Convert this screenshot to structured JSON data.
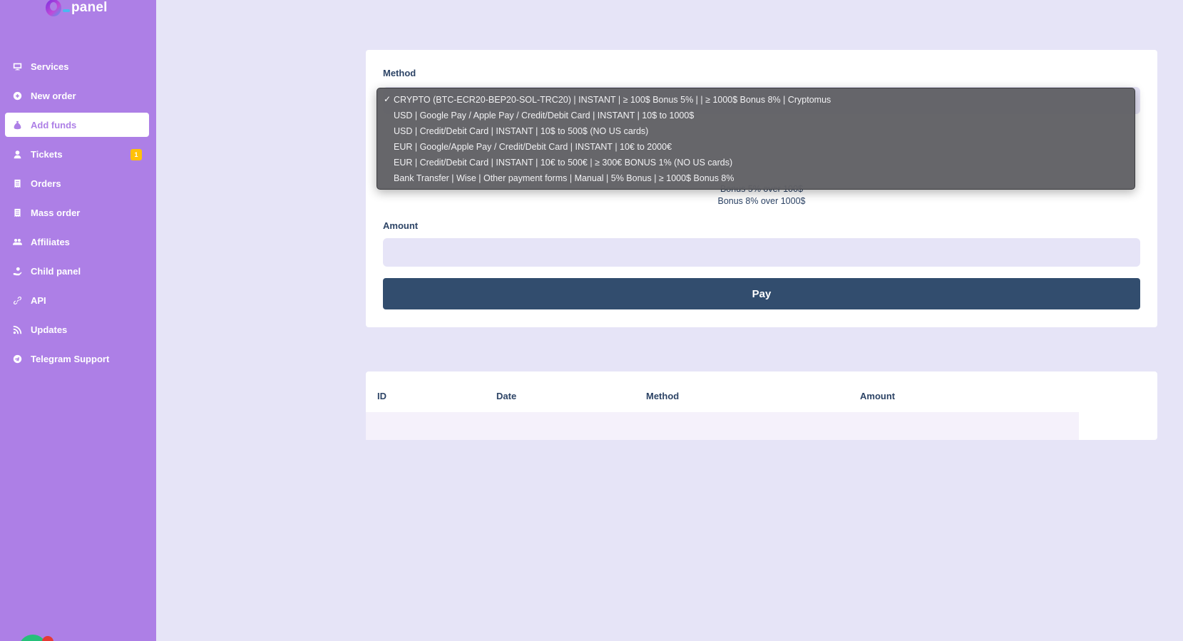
{
  "brand": {
    "name": "panel"
  },
  "sidebar": {
    "items": [
      {
        "label": "Services",
        "icon": "monitor-icon"
      },
      {
        "label": "New order",
        "icon": "plus-circle-icon"
      },
      {
        "label": "Add funds",
        "icon": "money-bag-icon",
        "active": true
      },
      {
        "label": "Tickets",
        "icon": "user-headset-icon",
        "badge": "1"
      },
      {
        "label": "Orders",
        "icon": "receipt-icon"
      },
      {
        "label": "Mass order",
        "icon": "receipt-icon"
      },
      {
        "label": "Affiliates",
        "icon": "users-icon"
      },
      {
        "label": "Child panel",
        "icon": "hand-holding-icon"
      },
      {
        "label": "API",
        "icon": "link-icon"
      },
      {
        "label": "Updates",
        "icon": "rss-icon"
      },
      {
        "label": "Telegram Support",
        "icon": "telegram-icon"
      }
    ]
  },
  "form": {
    "method_label": "Method",
    "description_partial": "Bonus 5% over 100$",
    "description_line2": "Bonus 8% over 1000$",
    "amount_label": "Amount",
    "amount_value": "",
    "pay_label": "Pay"
  },
  "dropdown": {
    "options": [
      {
        "label": "CRYPTO (BTC-ECR20-BEP20-SOL-TRC20) | INSTANT | ≥ 100$ Bonus 5% | | ≥ 1000$ Bonus 8% | Cryptomus",
        "checked": true
      },
      {
        "label": "USD | Google Pay / Apple Pay / Credit/Debit Card | INSTANT | 10$ to 1000$"
      },
      {
        "label": "USD | Credit/Debit Card | INSTANT | 10$ to 500$ (NO US cards)"
      },
      {
        "label": "EUR | Google/Apple Pay / Credit/Debit Card | INSTANT | 10€ to 2000€"
      },
      {
        "label": "EUR | Credit/Debit Card | INSTANT | 10€ to 500€ | ≥ 300€ BONUS 1% (NO US cards)"
      },
      {
        "label": "Bank Transfer | Wise | Other payment forms | Manual | 5% Bonus | ≥ 1000$ Bonus 8%"
      }
    ],
    "check_glyph": "✓"
  },
  "table": {
    "headers": [
      "ID",
      "Date",
      "Method",
      "Amount"
    ]
  },
  "colors": {
    "sidebar": "#ad7fe6",
    "background": "#e6e4f7",
    "button": "#324d6e",
    "badge": "#ffc107"
  }
}
